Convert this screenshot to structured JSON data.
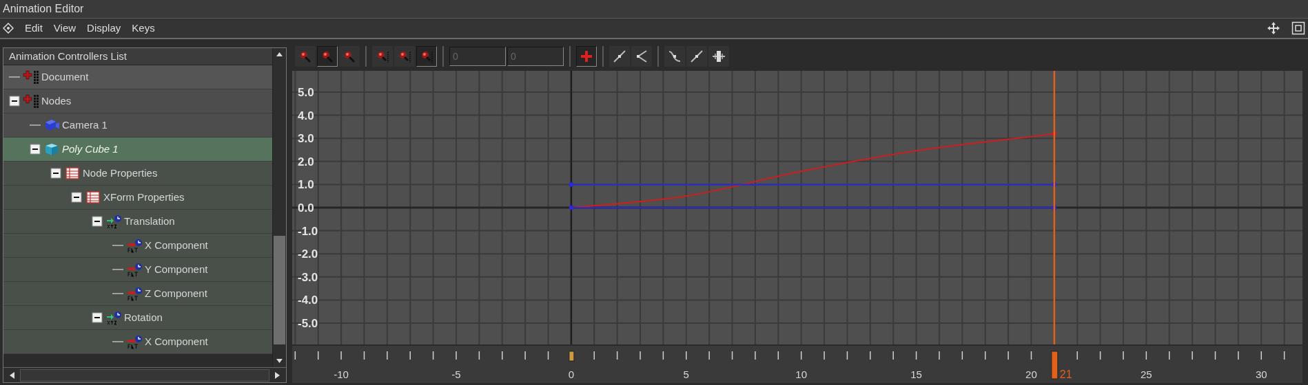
{
  "window": {
    "title": "Animation Editor"
  },
  "menu": [
    "Edit",
    "View",
    "Display",
    "Keys"
  ],
  "tree": {
    "header": "Animation Controllers List",
    "items": [
      {
        "label": "Document",
        "kind": "group",
        "selected": false
      },
      {
        "label": "Nodes",
        "kind": "group",
        "selected": false,
        "expanded": true,
        "children": [
          {
            "label": "Camera 1",
            "kind": "camera",
            "selected": false
          },
          {
            "label": "Poly Cube 1",
            "kind": "mesh",
            "selected": true,
            "expanded": true,
            "children": [
              {
                "label": "Node Properties",
                "kind": "properties",
                "selected": false,
                "expanded": true,
                "children": [
                  {
                    "label": "XForm Properties",
                    "kind": "properties",
                    "selected": false,
                    "expanded": true,
                    "children": [
                      {
                        "label": "Translation",
                        "kind": "vector",
                        "selected": false,
                        "expanded": true,
                        "children": [
                          {
                            "label": "X Component",
                            "kind": "float",
                            "selected": false
                          },
                          {
                            "label": "Y Component",
                            "kind": "float",
                            "selected": false
                          },
                          {
                            "label": "Z Component",
                            "kind": "float",
                            "selected": false
                          }
                        ]
                      },
                      {
                        "label": "Rotation",
                        "kind": "vector",
                        "selected": false,
                        "expanded": true,
                        "children": [
                          {
                            "label": "X Component",
                            "kind": "float",
                            "selected": false
                          }
                        ]
                      }
                    ]
                  }
                ]
              }
            ]
          }
        ]
      }
    ]
  },
  "toolbar": [
    [
      {
        "kind": "button",
        "pressed": false
      },
      {
        "kind": "button",
        "pressed": true
      },
      {
        "kind": "button",
        "pressed": false
      }
    ],
    [
      {
        "kind": "button",
        "pressed": false
      },
      {
        "kind": "button",
        "pressed": false
      },
      {
        "kind": "button",
        "pressed": true
      }
    ],
    [
      {
        "kind": "field",
        "value": "0",
        "disabled": true
      },
      {
        "kind": "field",
        "value": "0",
        "disabled": true
      }
    ],
    [
      {
        "kind": "button",
        "pressed": true
      }
    ],
    [
      {
        "kind": "button",
        "pressed": false
      },
      {
        "kind": "button",
        "pressed": false
      }
    ],
    [
      {
        "kind": "button",
        "pressed": false
      },
      {
        "kind": "button",
        "pressed": false
      },
      {
        "kind": "button",
        "pressed": false
      }
    ]
  ],
  "graph": {
    "chart_data": {
      "type": "line",
      "x": [
        0,
        5,
        10,
        15,
        20,
        21
      ],
      "series": [
        {
          "color": "#cc1f1f",
          "values": [
            0,
            0.5,
            1.57,
            2.46,
            3.07,
            3.2
          ]
        },
        {
          "color": "#2a2ad8",
          "values": [
            1,
            1,
            1,
            1,
            1,
            1
          ]
        },
        {
          "color": "#2a2ad8",
          "values": [
            0,
            0,
            0,
            0,
            0,
            0
          ]
        }
      ],
      "xlim": [
        -12.13,
        31.79
      ],
      "ylim": [
        -5.92,
        5.92
      ],
      "grid": true,
      "xticks": [
        -10,
        -5,
        0,
        5,
        10,
        15,
        20,
        25,
        30
      ],
      "yticks": [
        {
          "value": 5,
          "label": "5.0"
        },
        {
          "value": 4,
          "label": "4.0"
        },
        {
          "value": 3,
          "label": "3.0"
        },
        {
          "value": 2,
          "label": "2.0"
        },
        {
          "value": 1,
          "label": "1.0"
        },
        {
          "value": 0,
          "label": "0.0"
        },
        {
          "value": -1,
          "label": "-1.0"
        },
        {
          "value": -2,
          "label": "-2.0"
        },
        {
          "value": -3,
          "label": "-3.0"
        },
        {
          "value": -4,
          "label": "-4.0"
        },
        {
          "value": -5,
          "label": "-5.0"
        }
      ],
      "ref_lines": [
        {
          "axis": "x",
          "value": 21,
          "color": "#e0601c",
          "label": "21"
        }
      ]
    }
  }
}
